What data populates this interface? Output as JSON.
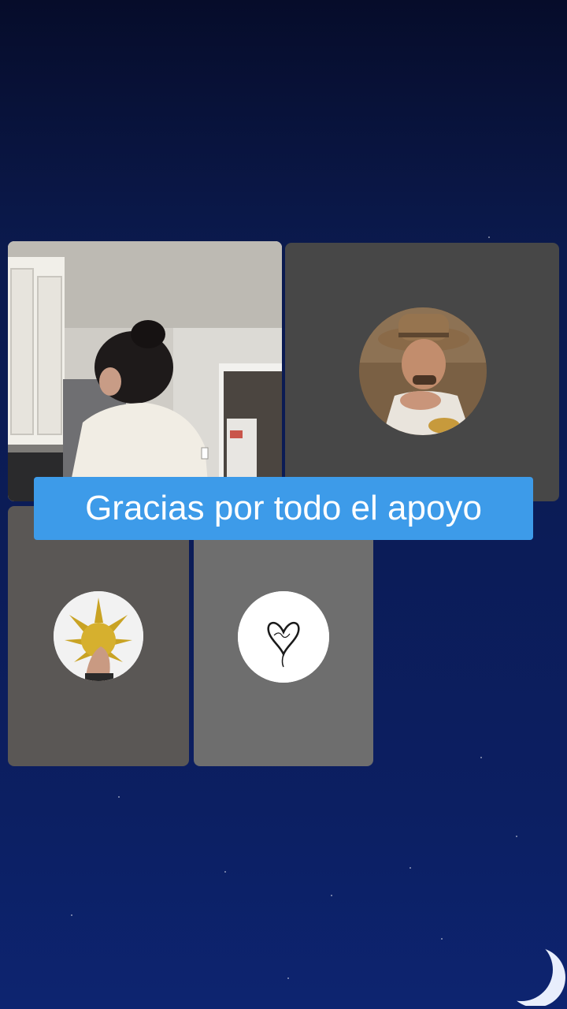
{
  "caption": {
    "text": "Gracias por todo el apoyo"
  },
  "participants": [
    {
      "id": "host",
      "kind": "live-video",
      "description_icon": "camera-feed"
    },
    {
      "id": "guest-1",
      "kind": "avatar",
      "avatar_icon": "man-with-hat-avatar"
    },
    {
      "id": "guest-2",
      "kind": "avatar",
      "avatar_icon": "golden-mask-avatar"
    },
    {
      "id": "guest-3",
      "kind": "avatar",
      "avatar_icon": "heart-signature-avatar"
    }
  ],
  "colors": {
    "caption_bg": "#3d9be9",
    "caption_text": "#ffffff",
    "background_top": "#060c2a",
    "background_bottom": "#0d2470"
  }
}
